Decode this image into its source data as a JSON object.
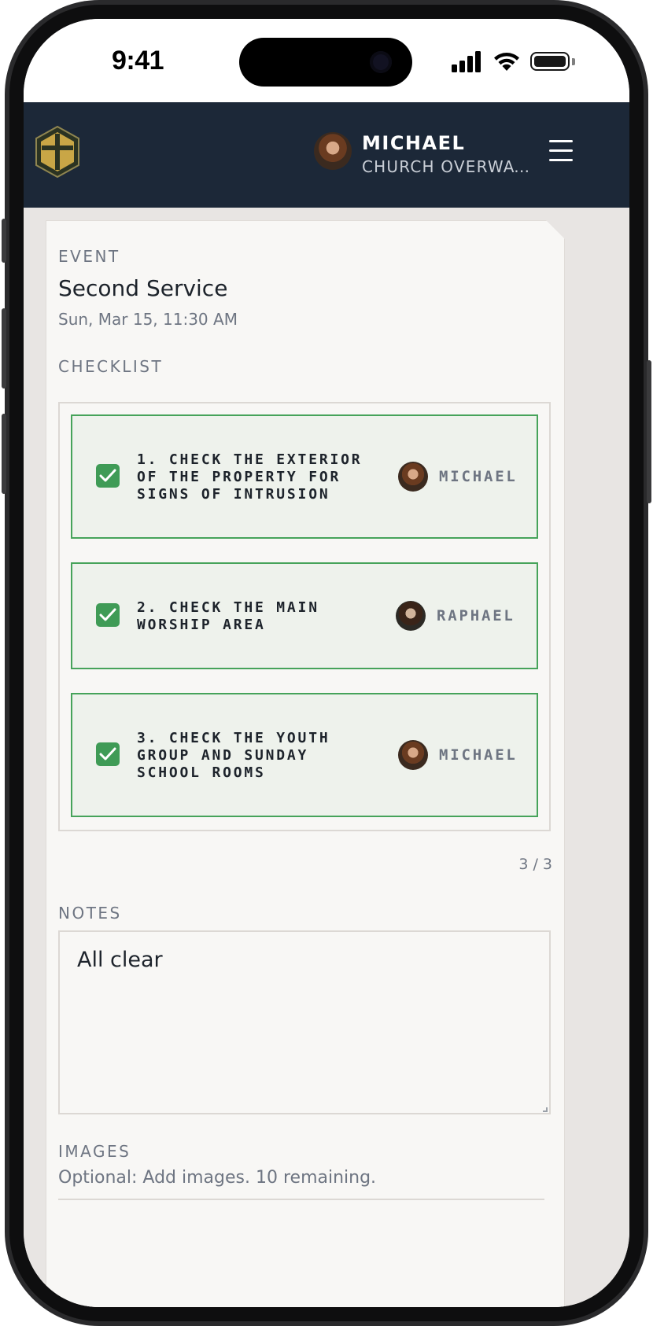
{
  "status_bar": {
    "time": "9:41"
  },
  "header": {
    "user_name": "MICHAEL",
    "user_org": "CHURCH OVERWATCH…",
    "logo_icon": "cross-shield-icon",
    "menu_icon": "hamburger-menu-icon"
  },
  "event": {
    "section_label": "EVENT",
    "title": "Second Service",
    "date": "Sun, Mar 15, 11:30 AM"
  },
  "checklist": {
    "section_label": "CHECKLIST",
    "items": [
      {
        "text": "1. CHECK THE EXTERIOR OF THE PROPERTY FOR SIGNS OF INTRUSION",
        "assignee": "MICHAEL",
        "checked": true
      },
      {
        "text": "2. CHECK THE MAIN WORSHIP AREA",
        "assignee": "RAPHAEL",
        "checked": true
      },
      {
        "text": "3. CHECK THE YOUTH GROUP AND SUNDAY SCHOOL ROOMS",
        "assignee": "MICHAEL",
        "checked": true
      }
    ],
    "progress": "3 / 3"
  },
  "notes": {
    "section_label": "NOTES",
    "value": "All clear"
  },
  "images": {
    "section_label": "IMAGES",
    "hint": "Optional: Add images. 10 remaining."
  },
  "colors": {
    "header_bg": "#1c2838",
    "accent_green": "#3f9b56",
    "page_bg": "#e8e5e3",
    "card_bg": "#f8f7f5"
  }
}
